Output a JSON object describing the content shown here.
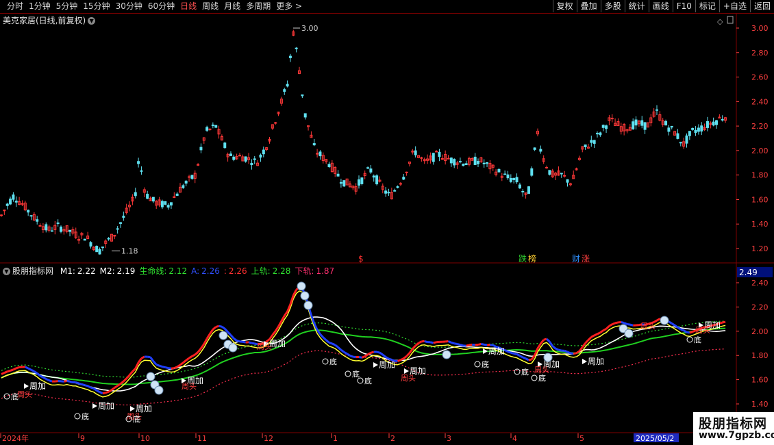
{
  "toolbar": {
    "left": [
      {
        "label": "分时"
      },
      {
        "label": "1分钟"
      },
      {
        "label": "5分钟"
      },
      {
        "label": "15分钟"
      },
      {
        "label": "30分钟"
      },
      {
        "label": "60分钟"
      },
      {
        "label": "日线",
        "active": true
      },
      {
        "label": "周线"
      },
      {
        "label": "月线"
      },
      {
        "label": "多周期"
      },
      {
        "label": "更多 >"
      }
    ],
    "right": [
      {
        "label": "复权"
      },
      {
        "label": "叠加"
      },
      {
        "label": "多股"
      },
      {
        "label": "统计"
      },
      {
        "label": "画线"
      },
      {
        "label": "F10"
      },
      {
        "label": "标记"
      },
      {
        "label": "+自选"
      },
      {
        "label": "返回"
      }
    ]
  },
  "main_pane": {
    "title": "美克家居(日线,前复权)",
    "high_label": "3.00",
    "low_label": "1.18",
    "y_ticks": [
      "3.00",
      "2.80",
      "2.60",
      "2.40",
      "2.20",
      "2.00",
      "1.80",
      "1.60",
      "1.40",
      "1.20"
    ],
    "event_tags": [
      {
        "text": "$",
        "color": "#ff3030"
      },
      {
        "text": "跌",
        "color": "#30d030"
      },
      {
        "text": "榜",
        "color": "#ffd030"
      },
      {
        "text": "财",
        "color": "#3090ff"
      },
      {
        "text": "涨",
        "color": "#ff4040"
      }
    ]
  },
  "indicator_pane": {
    "name": "股朋指标网",
    "params": [
      {
        "label": "M1:",
        "value": "2.22",
        "color": "#ffffff"
      },
      {
        "label": "M2:",
        "value": "2.19",
        "color": "#ffffff"
      },
      {
        "label": "生命线:",
        "value": "2.12",
        "color": "#30e030"
      },
      {
        "label": "A:",
        "value": "2.26",
        "color": "#3050ff"
      },
      {
        "label": ":",
        "value": "2.26",
        "color": "#ff3030"
      },
      {
        "label": "上轨:",
        "value": "2.28",
        "color": "#30e030"
      },
      {
        "label": "下轨:",
        "value": "1.87",
        "color": "#ff3070"
      }
    ],
    "current_value": "2.49",
    "y_ticks": [
      "2.40",
      "2.20",
      "2.00",
      "1.80",
      "1.60",
      "1.40"
    ],
    "labels": {
      "zhoujia": "周加",
      "zhoutou": "周头",
      "di": "底"
    }
  },
  "x_axis": {
    "labels": [
      "2024年",
      "9",
      "10",
      "11",
      "12",
      "1",
      "2",
      "3",
      "4",
      "5"
    ],
    "highlight": "2025/05/2"
  },
  "colors": {
    "up": "#ff3838",
    "down": "#5fe0f0",
    "grid": "#800000",
    "axis_text": "#ff4040",
    "white_line": "#ffffff",
    "green_line": "#20d020",
    "yellow_line": "#ffff30",
    "blue_line": "#2040ff",
    "red_line": "#ff2020"
  },
  "watermark": {
    "title": "股朋指标网",
    "url": "www.7gpzb.com"
  }
}
